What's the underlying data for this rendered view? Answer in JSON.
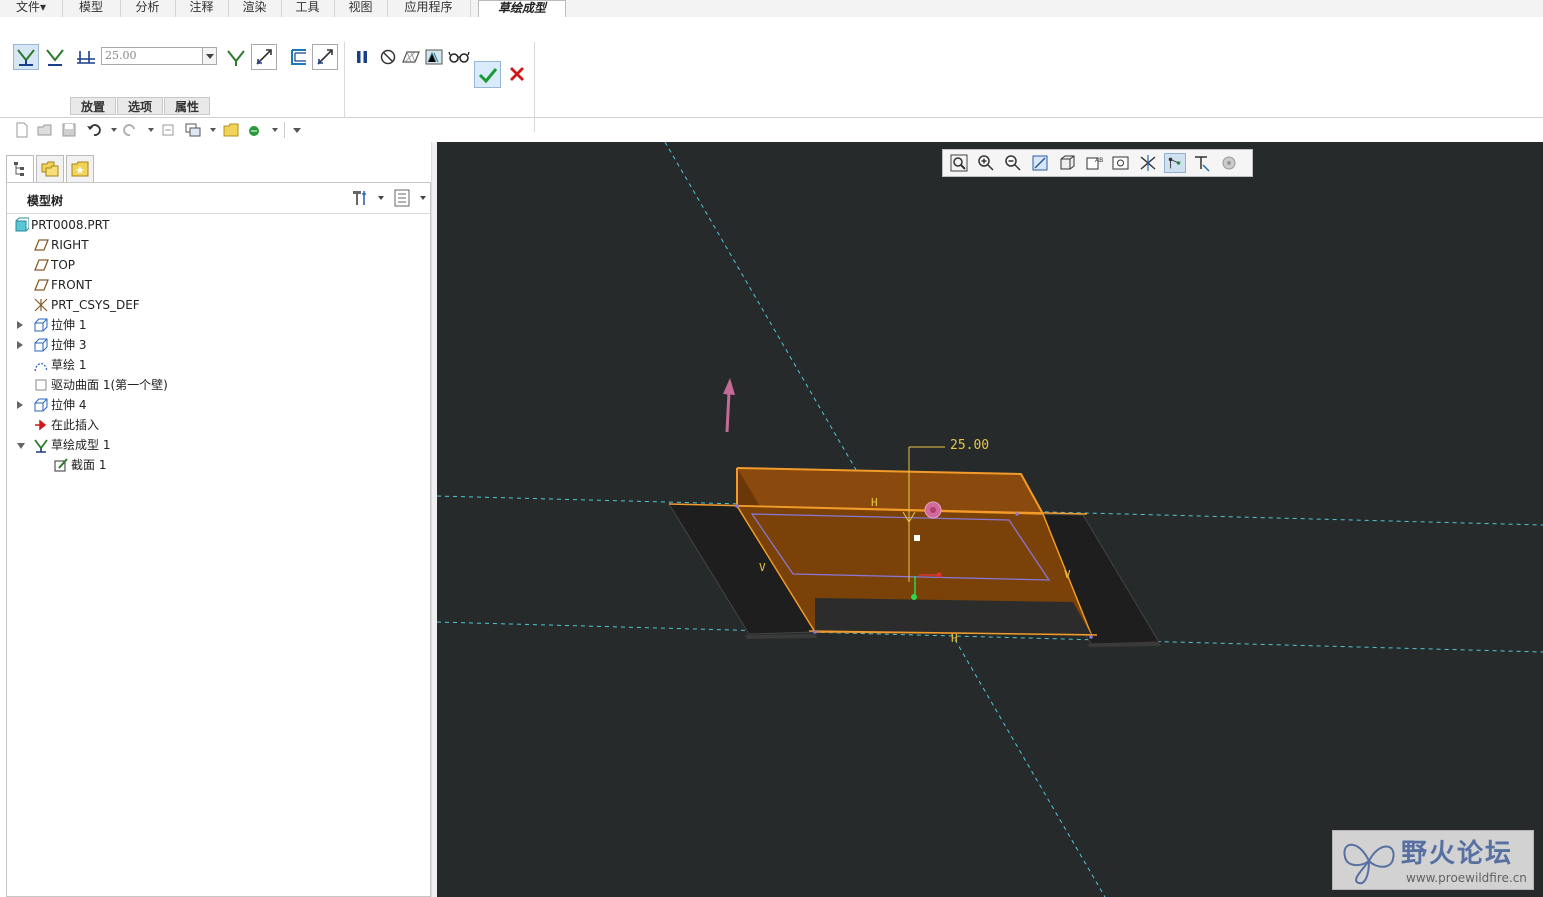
{
  "menu": {
    "tabs": [
      "文件▾",
      "模型",
      "分析",
      "注释",
      "渲染",
      "工具",
      "视图",
      "应用程序",
      "草绘成型"
    ],
    "active": "草绘成型"
  },
  "ribbon": {
    "depth_value": "25.00",
    "subtabs": [
      "放置",
      "选项",
      "属性"
    ]
  },
  "model_tree": {
    "title": "模型树",
    "items": [
      {
        "label": "PRT0008.PRT",
        "icon": "part-icon",
        "expander": "none"
      },
      {
        "label": "RIGHT",
        "icon": "datum-plane-icon",
        "expander": "none"
      },
      {
        "label": "TOP",
        "icon": "datum-plane-icon",
        "expander": "none"
      },
      {
        "label": "FRONT",
        "icon": "datum-plane-icon",
        "expander": "none"
      },
      {
        "label": "PRT_CSYS_DEF",
        "icon": "csys-icon",
        "expander": "none"
      },
      {
        "label": "拉伸 1",
        "icon": "extrude-icon",
        "expander": "closed"
      },
      {
        "label": "拉伸 3",
        "icon": "extrude-icon",
        "expander": "closed"
      },
      {
        "label": "草绘 1",
        "icon": "sketch-icon",
        "expander": "none"
      },
      {
        "label": "驱动曲面 1(第一个壁)",
        "icon": "surface-icon",
        "expander": "none"
      },
      {
        "label": "拉伸 4",
        "icon": "extrude-icon",
        "expander": "closed"
      },
      {
        "label": "在此插入",
        "icon": "insert-here-icon",
        "expander": "none"
      },
      {
        "label": "草绘成型 1",
        "icon": "sketched-form-icon",
        "expander": "open"
      },
      {
        "label": "截面 1",
        "icon": "section-icon",
        "expander": "none"
      }
    ]
  },
  "viewport": {
    "dimension_label": "25.00",
    "h_label": "H",
    "v_label": "V",
    "watermark_title": "野火论坛",
    "watermark_url": "www.proewildfire.cn"
  },
  "colors": {
    "viewport_bg": "#262a2b",
    "part_orange": "#7a4208",
    "edge_orange": "#f29a2a",
    "datum_cyan": "#4fc7d4",
    "flange_dark": "#1e1e1e",
    "dimension_yellow": "#e8c44a"
  }
}
